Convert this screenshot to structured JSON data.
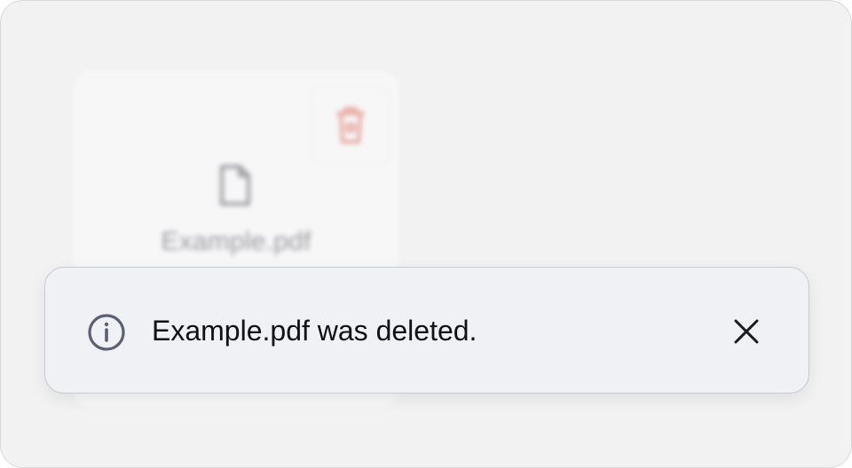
{
  "background_card": {
    "file_name": "Example.pdf",
    "delete_icon": "trash-icon",
    "file_icon": "file-icon"
  },
  "toast": {
    "message": "Example.pdf was deleted.",
    "info_icon": "info-icon",
    "close_icon": "close-icon"
  },
  "colors": {
    "frame_bg": "#f2f2f3",
    "toast_bg": "#f0f1f4",
    "toast_border": "#c8c9d1",
    "danger": "#e06a5c",
    "info_icon": "#5b6075"
  }
}
